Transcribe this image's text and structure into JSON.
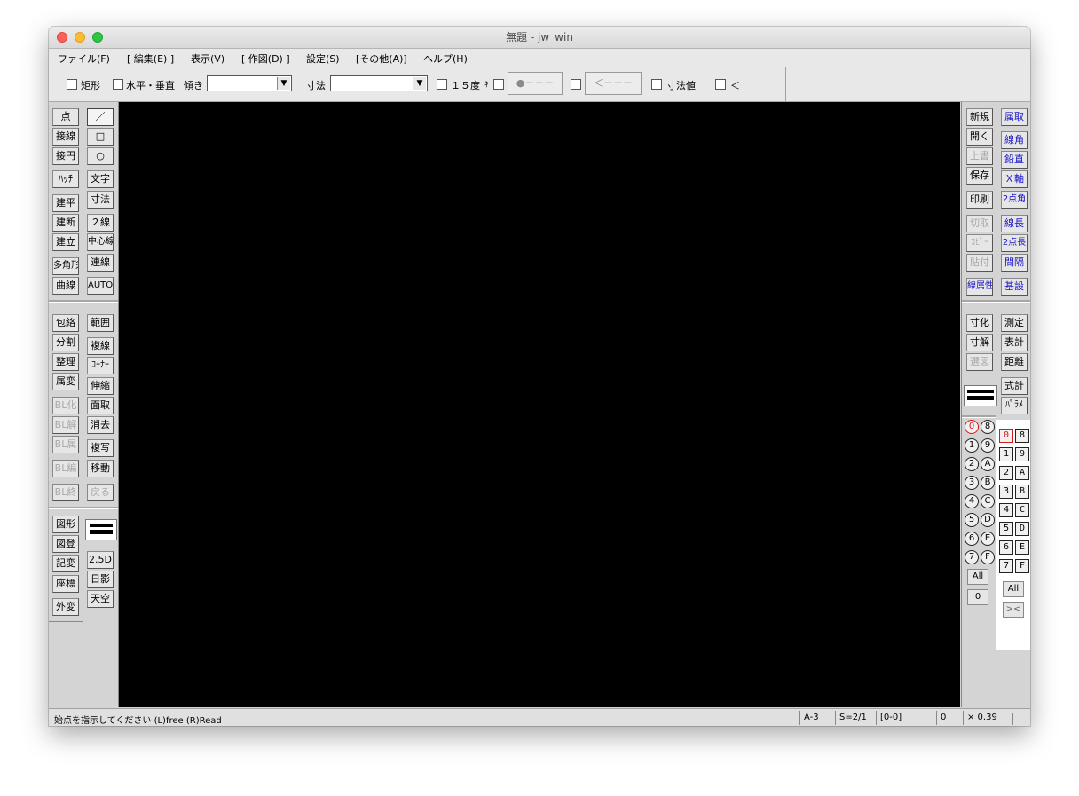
{
  "window": {
    "title": "無題 - jw_win"
  },
  "menu": [
    "ファイル(F)",
    "[ 編集(E) ]",
    "表示(V)",
    "[ 作図(D) ]",
    "設定(S)",
    "[その他(A)]",
    "ヘルプ(H)"
  ],
  "toolbar": {
    "rect_label": "矩形",
    "hv_label": "水平・垂直",
    "tilt_label": "傾き",
    "dim_label": "寸法",
    "deg15_label": "１５度",
    "deg15_suffix": "ｷ",
    "btn_dot": "●－－－",
    "btn_arrow": "＜－－－",
    "dimval_label": "寸法値",
    "lt_label": "＜"
  },
  "left_tools": {
    "col1_top": [
      "点",
      "接線",
      "接円",
      "ﾊｯﾁ",
      "建平",
      "建断",
      "建立",
      "多角形",
      "曲線"
    ],
    "col2_top": [
      "／",
      "□",
      "○",
      "文字",
      "寸法",
      "２線",
      "中心線",
      "連線",
      "AUTO"
    ],
    "col1_mid": [
      "包絡",
      "分割",
      "整理",
      "属変",
      "BL化",
      "BL解",
      "BL属",
      "BL編",
      "BL終"
    ],
    "col2_mid": [
      "範囲",
      "複線",
      "ｺｰﾅｰ",
      "伸縮",
      "面取",
      "消去",
      "複写",
      "移動",
      "戻る"
    ],
    "col1_bot": [
      "図形",
      "図登",
      "記変",
      "座標",
      "外変"
    ],
    "col2_bot": [
      "2.5D",
      "日影",
      "天空"
    ]
  },
  "right_tools": {
    "col1_top": [
      "新規",
      "開く",
      "上書",
      "保存",
      "印刷",
      "切取",
      "ｺﾋﾟｰ",
      "貼付",
      "線属性"
    ],
    "col2_top": [
      "属取",
      "線角",
      "鉛直",
      "Ｘ軸",
      "2点角",
      "線長",
      "2点長",
      "間隔",
      "基設"
    ],
    "col1_mid": [
      "寸化",
      "寸解",
      "選図"
    ],
    "col2_mid": [
      "測定",
      "表計",
      "距離",
      "式計",
      "ﾊﾟﾗﾒ"
    ]
  },
  "layers": {
    "circ_left": [
      "0",
      "1",
      "2",
      "3",
      "4",
      "5",
      "6",
      "7"
    ],
    "circ_right": [
      "8",
      "9",
      "A",
      "B",
      "C",
      "D",
      "E",
      "F"
    ],
    "sq_left": [
      "0",
      "1",
      "2",
      "3",
      "4",
      "5",
      "6",
      "7"
    ],
    "sq_right": [
      "8",
      "9",
      "A",
      "B",
      "C",
      "D",
      "E",
      "F"
    ],
    "all": "All",
    "zero": "0",
    "swap": "><"
  },
  "status": {
    "message": "始点を指示してください (L)free (R)Read",
    "paper": "A-3",
    "scale": "S=2/1",
    "layer": "[0-0]",
    "angle": "0",
    "zoom": "× 0.39"
  }
}
